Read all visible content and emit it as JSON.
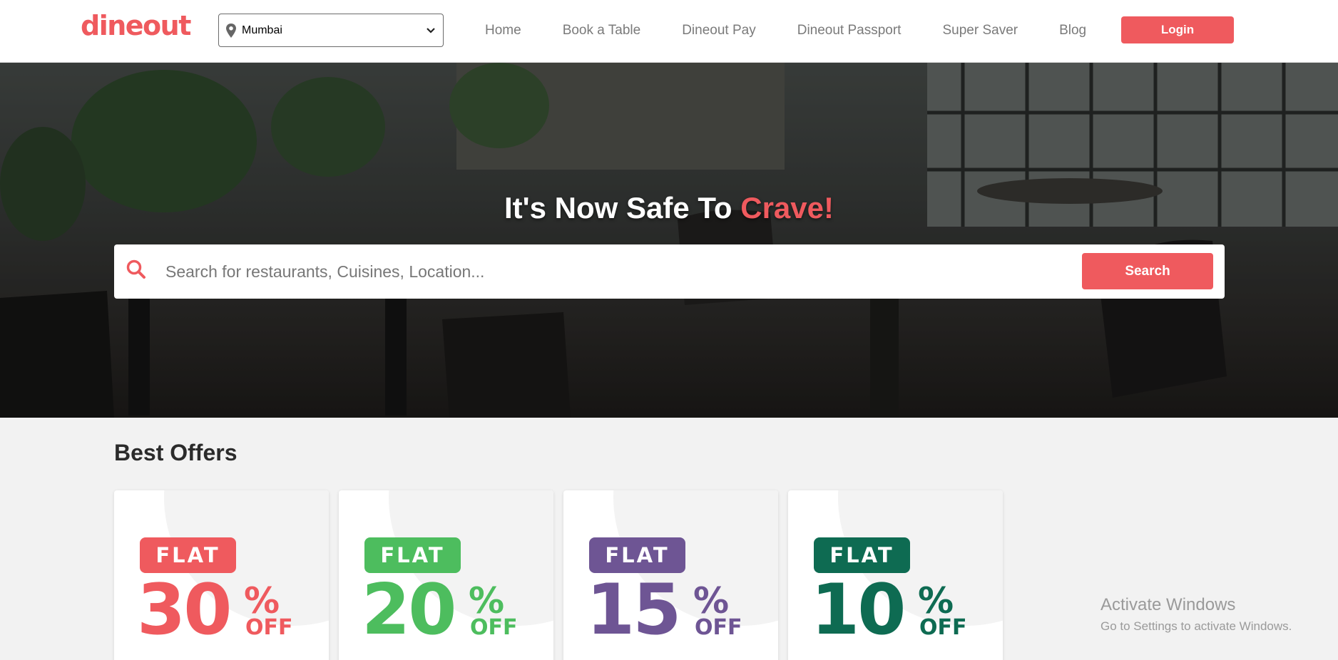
{
  "header": {
    "logo": "dineout",
    "city": "Mumbai",
    "nav": [
      "Home",
      "Book a Table",
      "Dineout Pay",
      "Dineout Passport",
      "Super Saver",
      "Blog"
    ],
    "login_label": "Login"
  },
  "hero": {
    "title_prefix": "It's Now Safe To ",
    "title_accent": "Crave!",
    "search_placeholder": "Search for restaurants, Cuisines, Location...",
    "search_button": "Search"
  },
  "offers": {
    "title": "Best Offers",
    "items": [
      {
        "badge": "FLAT",
        "value": "30",
        "percent": "%",
        "suffix": "OFF",
        "color": "#ef5a5e"
      },
      {
        "badge": "FLAT",
        "value": "20",
        "percent": "%",
        "suffix": "OFF",
        "color": "#4dbd5e"
      },
      {
        "badge": "FLAT",
        "value": "15",
        "percent": "%",
        "suffix": "OFF",
        "color": "#6e5594"
      },
      {
        "badge": "FLAT",
        "value": "10",
        "percent": "%",
        "suffix": "OFF",
        "color": "#0e6b52"
      }
    ]
  },
  "watermark": {
    "line1": "Activate Windows",
    "line2": "Go to Settings to activate Windows."
  },
  "colors": {
    "brand": "#ef5a5e"
  },
  "icons": [
    "map-pin-icon",
    "chevron-down-icon",
    "search-icon"
  ]
}
